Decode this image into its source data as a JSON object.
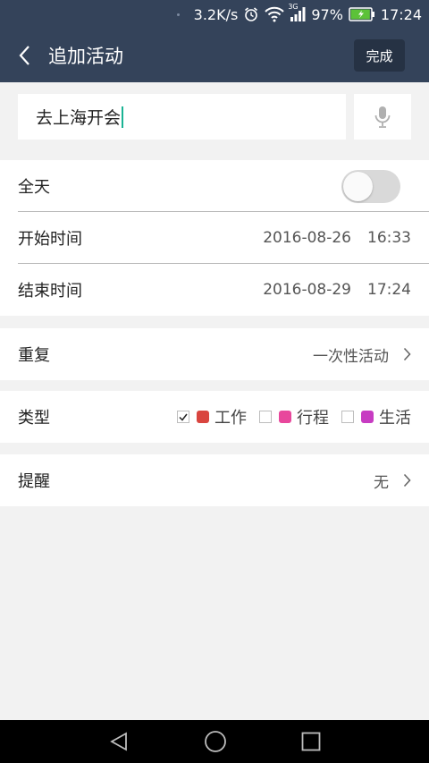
{
  "status": {
    "net_speed": "3.2K/s",
    "network_type": "3G",
    "battery": "97%",
    "battery_level": 0.97,
    "time": "17:24"
  },
  "app_bar": {
    "title": "追加活动",
    "done_label": "完成"
  },
  "title_input": {
    "value": "去上海开会"
  },
  "all_day": {
    "label": "全天",
    "on": false
  },
  "start": {
    "label": "开始时间",
    "date": "2016-08-26",
    "time": "16:33"
  },
  "end": {
    "label": "结束时间",
    "date": "2016-08-29",
    "time": "17:24"
  },
  "repeat": {
    "label": "重复",
    "value": "一次性活动"
  },
  "type": {
    "label": "类型",
    "options": [
      {
        "label": "工作",
        "checked": true,
        "color": "#d9453f"
      },
      {
        "label": "行程",
        "checked": false,
        "color": "#e8479c"
      },
      {
        "label": "生活",
        "checked": false,
        "color": "#c73cc2"
      }
    ]
  },
  "reminder": {
    "label": "提醒",
    "value": "无"
  },
  "colors": {
    "header": "#34435a",
    "done_button": "#263244",
    "caret": "#1ab394"
  }
}
